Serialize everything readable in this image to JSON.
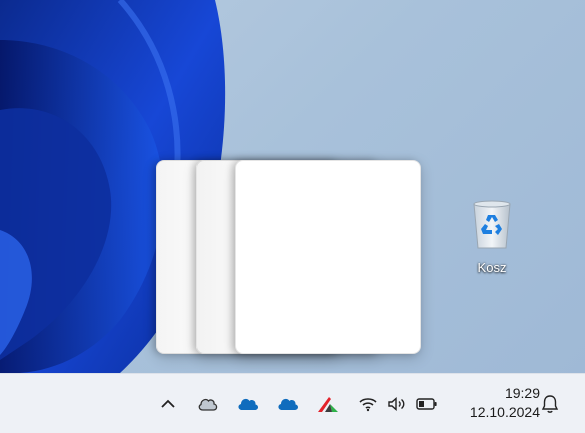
{
  "desktop": {
    "icons": [
      {
        "label": "Kosz",
        "icon": "recycle-bin-icon"
      }
    ],
    "task_switcher": {
      "window_count": 3
    }
  },
  "taskbar": {
    "tray_icons": [
      "show-hidden-icons-chevron-icon",
      "cloud-outline-icon",
      "onedrive-icon",
      "onedrive-icon",
      "app-red-green-icon",
      "wifi-icon",
      "speaker-icon",
      "battery-icon"
    ],
    "clock": {
      "time": "19:29",
      "date": "12.10.2024"
    },
    "notifications_icon": "bell-icon"
  },
  "colors": {
    "wallpaper": "#a8c1da",
    "bloom_blue": "#0a3fbf",
    "taskbar": "#eef1f6",
    "onedrive": "#0f6cbd"
  }
}
